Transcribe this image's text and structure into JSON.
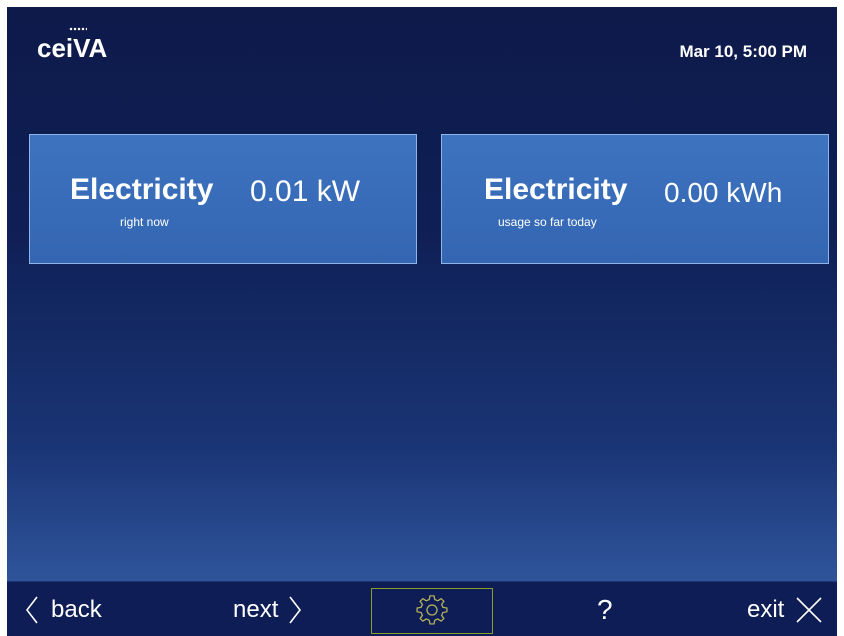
{
  "header": {
    "logo": "ceiVA",
    "datetime": "Mar 10, 5:00 PM"
  },
  "tiles": [
    {
      "label": "Electricity",
      "value": "0.01 kW",
      "sub": "right now"
    },
    {
      "label": "Electricity",
      "value": "0.00 kWh",
      "sub": "usage so far today"
    }
  ],
  "nav": {
    "back": "back",
    "next": "next",
    "help": "?",
    "exit": "exit",
    "settings_icon": "gear-icon"
  },
  "colors": {
    "background_top": "#0d1a4a",
    "background_bottom": "#3a60a3",
    "tile": "#3a6eb9",
    "settings_border": "#8a9c2a",
    "gear": "#b7b25a"
  }
}
